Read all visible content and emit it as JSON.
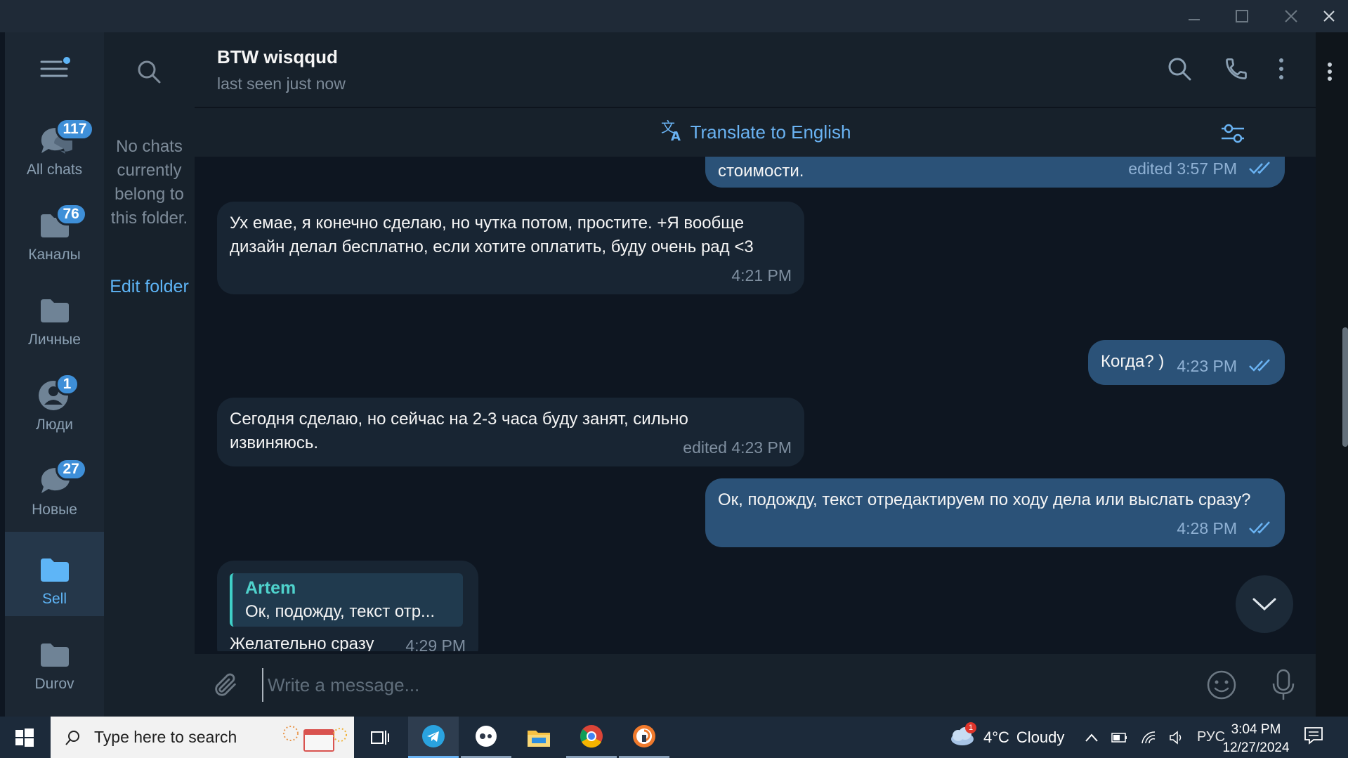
{
  "folders": [
    {
      "label": "All chats",
      "badge": "117",
      "icon": "chats-icon"
    },
    {
      "label": "Каналы",
      "badge": "76",
      "icon": "folder-icon"
    },
    {
      "label": "Личные",
      "badge": "",
      "icon": "folder-icon"
    },
    {
      "label": "Люди",
      "badge": "1",
      "icon": "person-icon"
    },
    {
      "label": "Новые",
      "badge": "27",
      "icon": "chats-icon"
    },
    {
      "label": "Sell",
      "badge": "",
      "icon": "folder-icon"
    },
    {
      "label": "Durov",
      "badge": "",
      "icon": "folder-icon"
    }
  ],
  "chatlist": {
    "empty_text": "No chats currently belong to this folder.",
    "edit_folder": "Edit folder"
  },
  "header": {
    "title": "BTW wisqqud",
    "status": "last seen just now"
  },
  "translate": {
    "label": "Translate to English"
  },
  "messages": [
    {
      "dir": "out",
      "text": "стоимости.",
      "time": "edited 3:57 PM",
      "read": true
    },
    {
      "dir": "in",
      "text": "Ух емае, я конечно сделаю, но чутка потом, простите. +Я вообще дизайн делал бесплатно, если хотите оплатить, буду очень рад <3",
      "time": "4:21 PM"
    },
    {
      "dir": "out",
      "text": "Когда? )",
      "time": "4:23 PM",
      "read": true
    },
    {
      "dir": "in",
      "text": "Сегодня сделаю, но сейчас на 2-3 часа буду занят, сильно извиняюсь.",
      "time": "edited 4:23 PM"
    },
    {
      "dir": "out",
      "text": "Ок, подожду, текст отредактируем по ходу дела или выслать сразу?",
      "time": "4:28 PM",
      "read": true
    },
    {
      "dir": "in",
      "text": "Желательно сразу",
      "time": "4:29 PM",
      "reply_author": "Artem",
      "reply_text": "Ок, подожду, текст отр..."
    }
  ],
  "composer": {
    "placeholder": "Write a message..."
  },
  "taskbar": {
    "search_placeholder": "Type here to search",
    "weather": {
      "temp": "4°C",
      "condition": "Cloudy",
      "alert": "1"
    },
    "language": "РУС",
    "time": "3:04 PM",
    "date": "12/27/2024"
  },
  "colors": {
    "accent": "#5eb5f7",
    "outgoing_bubble": "#2b5278",
    "incoming_bubble": "#182533",
    "badge": "#3e8fd8"
  }
}
